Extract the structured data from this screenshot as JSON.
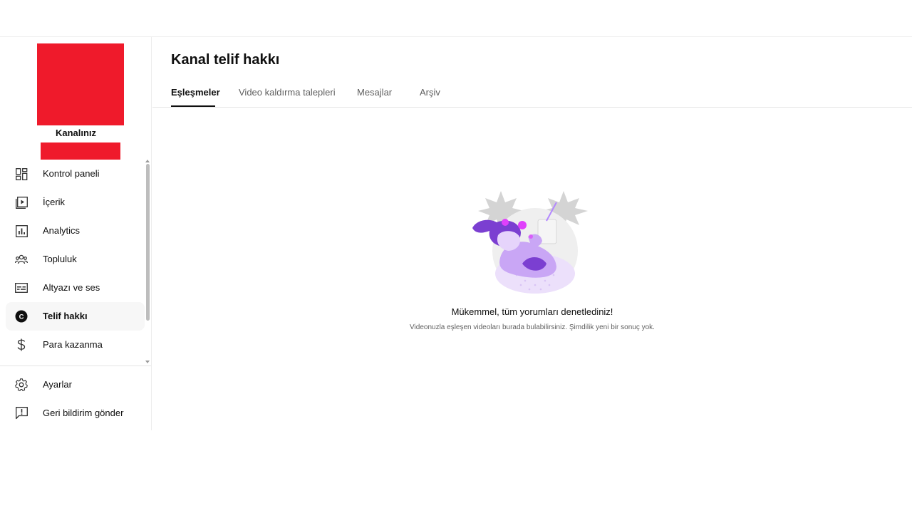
{
  "page": {
    "title": "Kanal telif hakkı"
  },
  "channel": {
    "name": "Kanalınız"
  },
  "sidebar": {
    "items": [
      {
        "label": "Kontrol paneli",
        "icon": "dashboard-icon"
      },
      {
        "label": "İçerik",
        "icon": "content-icon"
      },
      {
        "label": "Analytics",
        "icon": "analytics-icon"
      },
      {
        "label": "Topluluk",
        "icon": "community-icon"
      },
      {
        "label": "Altyazı ve ses",
        "icon": "subtitles-icon"
      },
      {
        "label": "Telif hakkı",
        "icon": "copyright-icon",
        "active": true
      },
      {
        "label": "Para kazanma",
        "icon": "dollar-icon"
      }
    ],
    "bottom_items": [
      {
        "label": "Ayarlar",
        "icon": "gear-icon"
      },
      {
        "label": "Geri bildirim gönder",
        "icon": "feedback-icon"
      }
    ]
  },
  "tabs": [
    {
      "label": "Eşleşmeler",
      "active": true
    },
    {
      "label": "Video kaldırma talepleri"
    },
    {
      "label": "Mesajlar"
    },
    {
      "label": "Arşiv"
    }
  ],
  "empty_state": {
    "title": "Mükemmel, tüm yorumları denetlediniz!",
    "subtitle": "Videonuzla eşleşen videoları burada bulabilirsiniz. Şimdilik yeni bir sonuç yok."
  },
  "colors": {
    "redacted": "#ef1a2b",
    "accent_purple": "#7b3fd1",
    "illustration_pink": "#e040fb"
  }
}
